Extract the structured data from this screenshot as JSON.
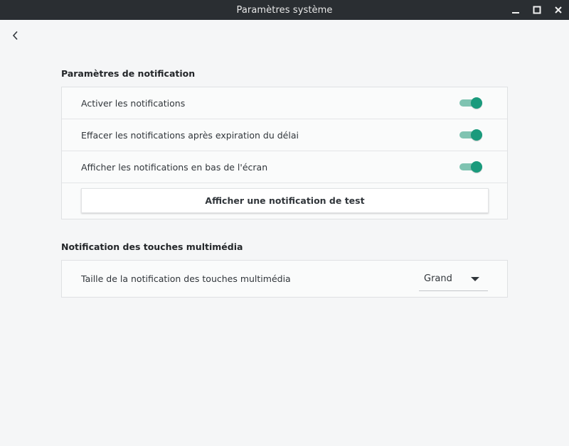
{
  "window": {
    "title": "Paramètres système",
    "controls": [
      "minimize-icon",
      "maximize-icon",
      "close-icon"
    ]
  },
  "nav": {
    "back_icon": "chevron-left-icon"
  },
  "notification_settings": {
    "title": "Paramètres de notification",
    "rows": [
      {
        "label": "Activer les notifications",
        "enabled": true
      },
      {
        "label": "Effacer les notifications après expiration du délai",
        "enabled": true
      },
      {
        "label": "Afficher les notifications en bas de l'écran",
        "enabled": true
      }
    ],
    "test_button_label": "Afficher une notification de test"
  },
  "multimedia_settings": {
    "title": "Notification des touches multimédia",
    "size_label": "Taille de la notification des touches multimédia",
    "size_value": "Grand"
  },
  "colors": {
    "accent": "#1a9a7c",
    "accent_track": "#7fc3b1",
    "titlebar": "#2a2e32",
    "background": "#f5f6f7"
  }
}
